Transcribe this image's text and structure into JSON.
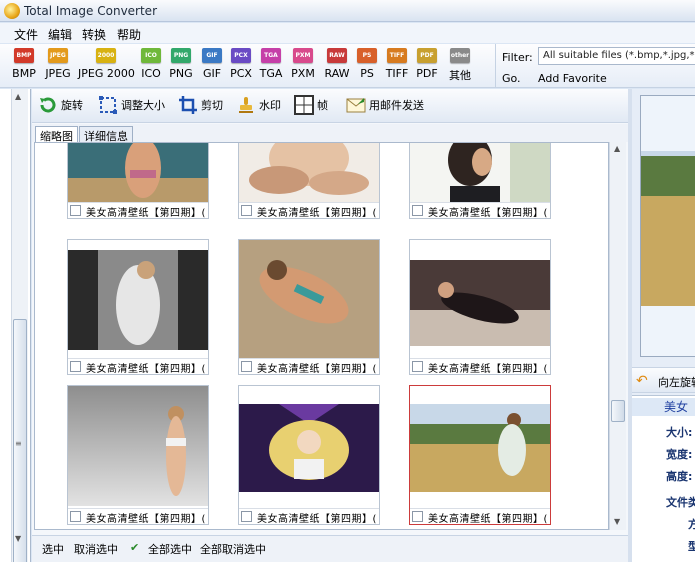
{
  "window": {
    "title": "Total Image Converter"
  },
  "menu": [
    "文件",
    "编辑",
    "转换",
    "帮助"
  ],
  "formats": [
    {
      "label": "BMP",
      "badge": "BMP",
      "color": "#d23a2a"
    },
    {
      "label": "JPEG",
      "badge": "JPEG",
      "color": "#e39a1c"
    },
    {
      "label": "JPEG 2000",
      "badge": "2000",
      "color": "#d8b212"
    },
    {
      "label": "ICO",
      "badge": "ICO",
      "color": "#6fb83a"
    },
    {
      "label": "PNG",
      "badge": "PNG",
      "color": "#32a86b"
    },
    {
      "label": "GIF",
      "badge": "GIF",
      "color": "#3b79c4"
    },
    {
      "label": "PCX",
      "badge": "PCX",
      "color": "#6a4bc4"
    },
    {
      "label": "TGA",
      "badge": "TGA",
      "color": "#c540a8"
    },
    {
      "label": "PXM",
      "badge": "PXM",
      "color": "#d84a8c"
    },
    {
      "label": "RAW",
      "badge": "RAW",
      "color": "#c83a3a"
    },
    {
      "label": "PS",
      "badge": "PS",
      "color": "#d8602a"
    },
    {
      "label": "TIFF",
      "badge": "TIFF",
      "color": "#d77b20"
    },
    {
      "label": "PDF",
      "badge": "PDF",
      "color": "#c8a030"
    },
    {
      "label": "其他",
      "badge": "other",
      "color": "#8a8a8a"
    }
  ],
  "filter": {
    "label": "Filter:",
    "value": "All suitable files (*.bmp,*.jpg,*.jpeg,*.",
    "go": "Go.",
    "add_favorite": "Add Favorite"
  },
  "actions": [
    "旋转",
    "调整大小",
    "剪切",
    "水印",
    "帧",
    "用邮件发送"
  ],
  "tabs": [
    "缩略图",
    "详细信息"
  ],
  "thumbnails": [
    {
      "caption": "美女高清壁纸【第四期】(",
      "selected": false
    },
    {
      "caption": "美女高清壁纸【第四期】(",
      "selected": false
    },
    {
      "caption": "美女高清壁纸【第四期】(",
      "selected": false
    },
    {
      "caption": "美女高清壁纸【第四期】(",
      "selected": false
    },
    {
      "caption": "美女高清壁纸【第四期】(",
      "selected": false
    },
    {
      "caption": "美女高清壁纸【第四期】(",
      "selected": false
    },
    {
      "caption": "美女高清壁纸【第四期】(",
      "selected": false
    },
    {
      "caption": "美女高清壁纸【第四期】(",
      "selected": false
    },
    {
      "caption": "美女高清壁纸【第四期】(",
      "selected": true
    }
  ],
  "selection_bar": {
    "select": "选中",
    "deselect": "取消选中",
    "select_all": "全部选中",
    "deselect_all": "全部取消选中"
  },
  "right_panel": {
    "rotate_label": "向左旋转",
    "info_header": "美女",
    "fields": [
      "大小:",
      "宽度:",
      "高度:",
      "文件类",
      "方",
      "型"
    ]
  }
}
